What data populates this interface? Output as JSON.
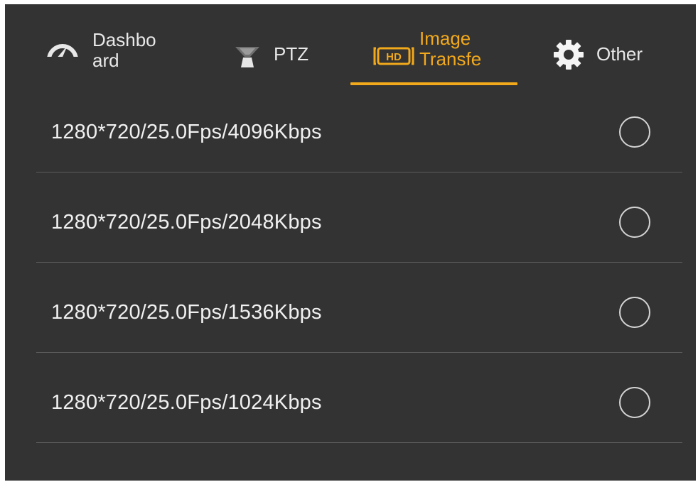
{
  "tabs": [
    {
      "id": "dashboard",
      "label": "Dashbo\nard",
      "icon": "speedometer-icon",
      "active": false
    },
    {
      "id": "ptz",
      "label": "PTZ",
      "icon": "gimbal-icon",
      "active": false
    },
    {
      "id": "image",
      "label": "Image\nTransfe",
      "icon": "hd-icon",
      "active": true
    },
    {
      "id": "other",
      "label": "Other",
      "icon": "gear-icon",
      "active": false
    }
  ],
  "options": [
    {
      "label": "1280*720/25.0Fps/4096Kbps",
      "selected": false
    },
    {
      "label": "1280*720/25.0Fps/2048Kbps",
      "selected": false
    },
    {
      "label": "1280*720/25.0Fps/1536Kbps",
      "selected": false
    },
    {
      "label": "1280*720/25.0Fps/1024Kbps",
      "selected": false
    }
  ],
  "colors": {
    "background": "#333333",
    "accent": "#f2a91b",
    "text": "#eeeeee",
    "divider": "#5c5c5c"
  }
}
